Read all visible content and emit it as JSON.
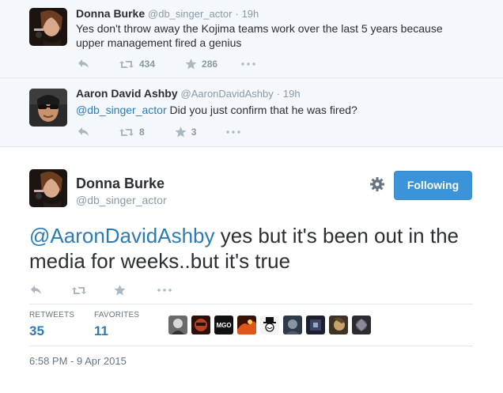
{
  "replies": [
    {
      "name": "Donna Burke",
      "handle": "@db_singer_actor",
      "time": "19h",
      "text": "Yes don't throw away the Kojima teams work over the last 5 years because upper management fired a genius",
      "retweets": "434",
      "favorites": "286"
    },
    {
      "name": "Aaron David Ashby",
      "handle": "@AaronDavidAshby",
      "time": "19h",
      "mention": "@db_singer_actor",
      "text": " Did you just confirm that he was fired?",
      "retweets": "8",
      "favorites": "3"
    }
  ],
  "main_tweet": {
    "name": "Donna Burke",
    "handle": "@db_singer_actor",
    "follow_label": "Following",
    "mention": "@AaronDavidAshby",
    "text": " yes but it's been out in the media for weeks..but it's true",
    "stats": {
      "retweets_label": "RETWEETS",
      "retweets_value": "35",
      "favorites_label": "FAVORITES",
      "favorites_value": "11"
    },
    "timestamp": "6:58 PM - 9 Apr 2015"
  },
  "favoriter_avatars": [
    "avatar-1",
    "avatar-2",
    "avatar-mgo",
    "avatar-4",
    "avatar-5",
    "avatar-6",
    "avatar-7",
    "avatar-8",
    "avatar-9",
    "avatar-10"
  ],
  "colors": {
    "link": "#2b7bb9",
    "follow_button": "#3b94d9",
    "muted": "#8899a6"
  }
}
